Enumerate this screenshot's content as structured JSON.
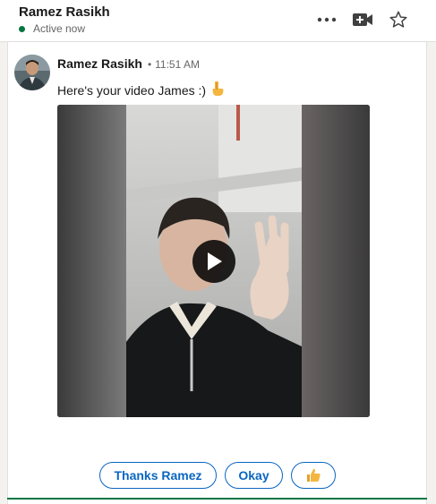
{
  "header": {
    "name": "Ramez Rasikh",
    "status": "Active now",
    "status_color": "#057642",
    "icons": [
      "more-horizontal-icon",
      "video-call-icon",
      "star-icon"
    ]
  },
  "message": {
    "sender": "Ramez Rasikh",
    "separator": "•",
    "time": "11:51 AM",
    "text": "Here's your video James :)",
    "text_emoji": "pointing-down-emoji",
    "attachment": "video"
  },
  "quick_replies": {
    "thanks": "Thanks Ramez",
    "okay": "Okay",
    "thumbs_up": "👍"
  },
  "colors": {
    "accent": "#0a66c2",
    "online": "#057642"
  }
}
